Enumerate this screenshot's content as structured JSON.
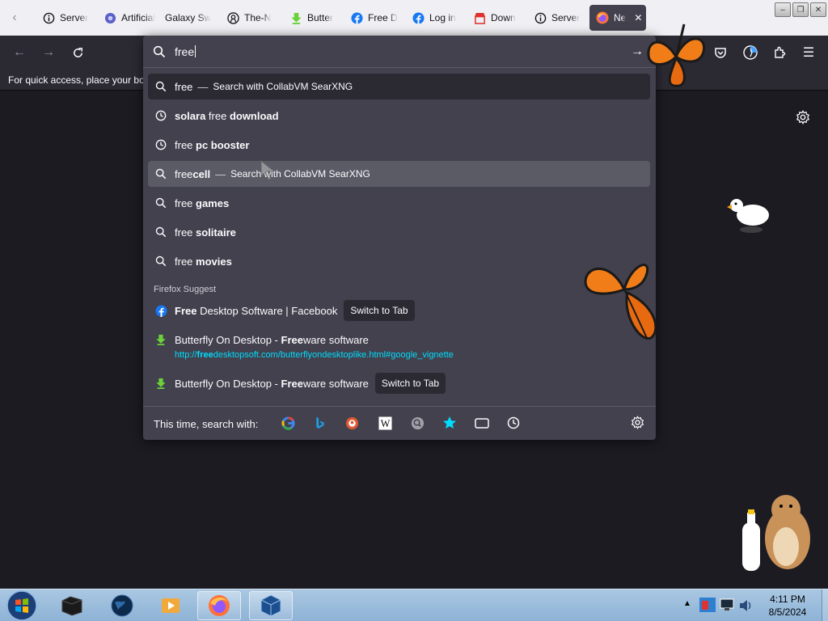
{
  "colors": {
    "page_bg": "#1c1b22",
    "toolbar": "#2b2a33",
    "dropdown": "#42414d",
    "hover_row": "#5b5b66",
    "url_link": "#00ddff",
    "bookmark_arrow": "#54ffbd",
    "facebook": "#1877f2",
    "taskbar": "#9ebfde"
  },
  "tabs": [
    {
      "label": "Server",
      "icon": "info-icon"
    },
    {
      "label": "Artificial",
      "icon": "globe-blue-icon"
    },
    {
      "label": "Galaxy Sw",
      "icon": "none"
    },
    {
      "label": "The-N",
      "icon": "github-icon"
    },
    {
      "label": "Butter",
      "icon": "download-arrow-icon"
    },
    {
      "label": "Free D",
      "icon": "facebook-icon"
    },
    {
      "label": "Log in",
      "icon": "facebook-icon"
    },
    {
      "label": "Down",
      "icon": "store-icon"
    },
    {
      "label": "Server",
      "icon": "info-icon"
    },
    {
      "label": "Ne",
      "icon": "firefox-icon",
      "active": true
    }
  ],
  "bookmarks": {
    "hint": "For quick access, place your boo"
  },
  "urlbar": {
    "value": "free",
    "suggestions": [
      {
        "plain": "free",
        "bold": "",
        "sep": "—",
        "action": "Search with CollabVM SearXNG",
        "icon": "search-icon"
      },
      {
        "parts": [
          {
            "t": "solara",
            "b": true
          },
          {
            "t": " free ",
            "b": false
          },
          {
            "t": "download",
            "b": true
          }
        ],
        "icon": "history-icon"
      },
      {
        "parts": [
          {
            "t": "free ",
            "b": false
          },
          {
            "t": "pc booster",
            "b": true
          }
        ],
        "icon": "history-icon"
      },
      {
        "plain": "free",
        "bold": "cell",
        "sep": "—",
        "action": "Search with CollabVM SearXNG",
        "icon": "search-icon"
      },
      {
        "plain": "free ",
        "bold": "games",
        "icon": "search-icon"
      },
      {
        "plain": "free ",
        "bold": "solitaire",
        "icon": "search-icon"
      },
      {
        "plain": "free ",
        "bold": "movies",
        "icon": "search-icon"
      }
    ],
    "firefox_suggest_label": "Firefox Suggest",
    "suggest_items": [
      {
        "bold": "Free",
        "rest": " Desktop Software | Facebook",
        "switch": "Switch to Tab",
        "icon": "facebook-icon"
      },
      {
        "pre": "Butterfly On Desktop - ",
        "bold": "Free",
        "rest": "ware software",
        "url_pre": "http://",
        "url_bold": "free",
        "url_rest": "desktopsoft.com/butterflyondesktoplike.html#google_vignette",
        "icon": "download-arrow-icon"
      },
      {
        "pre": "Butterfly On Desktop - ",
        "bold": "Free",
        "rest": "ware software",
        "switch": "Switch to Tab",
        "icon": "download-arrow-icon"
      }
    ],
    "oneoff_label": "This time, search with:",
    "engines": [
      "google-icon",
      "bing-icon",
      "duckduckgo-icon",
      "wikipedia-icon",
      "searxng-icon",
      "bookmarks-star-icon",
      "tabs-icon",
      "history-icon"
    ]
  },
  "taskbar": {
    "apps": [
      "start-orb-icon",
      "terminal-box-icon",
      "globe-icon",
      "media-player-icon",
      "firefox-icon",
      "virtualbox-icon"
    ],
    "time": "4:11 PM",
    "date": "8/5/2024"
  }
}
